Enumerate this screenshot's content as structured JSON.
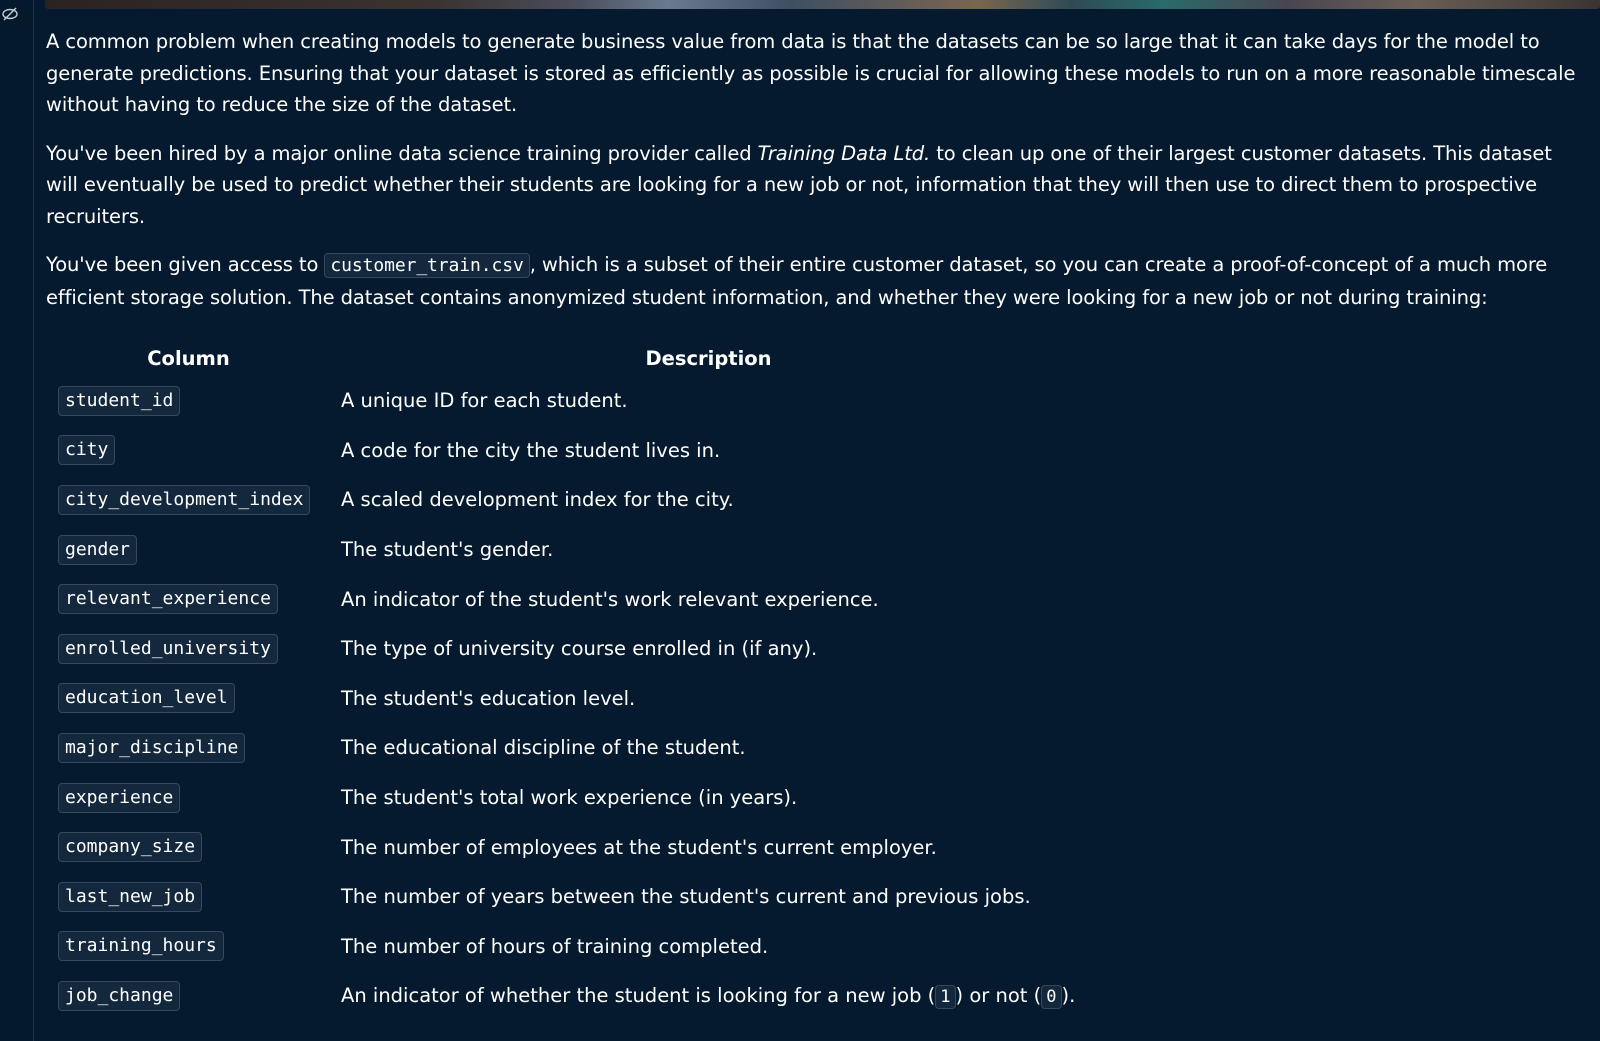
{
  "paragraphs": {
    "p1": "A common problem when creating models to generate business value from data is that the datasets can be so large that it can take days for the model to generate predictions. Ensuring that your dataset is stored as efficiently as possible is crucial for allowing these models to run on a more reasonable timescale without having to reduce the size of the dataset.",
    "p2_before": "You've been hired by a major online data science training provider called ",
    "p2_company": "Training Data Ltd.",
    "p2_after": " to clean up one of their largest customer datasets. This dataset will eventually be used to predict whether their students are looking for a new job or not, information that they will then use to direct them to prospective recruiters.",
    "p3_before": "You've been given access to ",
    "p3_file": "customer_train.csv",
    "p3_after": ", which is a subset of their entire customer dataset, so you can create a proof-of-concept of a much more efficient storage solution. The dataset contains anonymized student information, and whether they were looking for a new job or not during training:"
  },
  "table": {
    "headers": {
      "column": "Column",
      "description": "Description"
    },
    "rows": [
      {
        "column": "student_id",
        "description": "A unique ID for each student."
      },
      {
        "column": "city",
        "description": "A code for the city the student lives in."
      },
      {
        "column": "city_development_index",
        "description": "A scaled development index for the city."
      },
      {
        "column": "gender",
        "description": "The student's gender."
      },
      {
        "column": "relevant_experience",
        "description": "An indicator of the student's work relevant experience."
      },
      {
        "column": "enrolled_university",
        "description": "The type of university course enrolled in (if any)."
      },
      {
        "column": "education_level",
        "description": "The student's education level."
      },
      {
        "column": "major_discipline",
        "description": "The educational discipline of the student."
      },
      {
        "column": "experience",
        "description": "The student's total work experience (in years)."
      },
      {
        "column": "company_size",
        "description": "The number of employees at the student's current employer."
      },
      {
        "column": "last_new_job",
        "description": "The number of years between the student's current and previous jobs."
      },
      {
        "column": "training_hours",
        "description": "The number of hours of training completed."
      }
    ],
    "last_row": {
      "column": "job_change",
      "desc_before": "An indicator of whether the student is looking for a new job (",
      "code_yes": "1",
      "desc_middle": ") or not (",
      "code_no": "0",
      "desc_after": ")."
    }
  },
  "icons": {
    "sidebar_toggle": "eye-off-icon"
  }
}
